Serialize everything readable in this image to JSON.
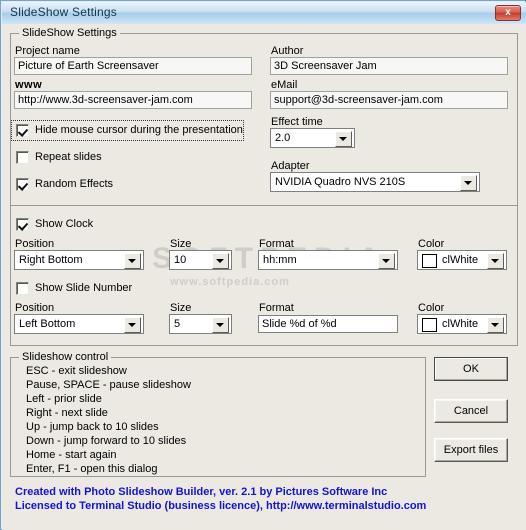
{
  "window": {
    "title": "SlideShow Settings",
    "close_label": "x",
    "accent": "#6ba7d6",
    "titlebar_color": "#a8cde9",
    "face_color": "#ece9e3"
  },
  "main_group": {
    "caption": "SlideShow Settings"
  },
  "fields": {
    "project_name": {
      "label": "Project name",
      "value": "Picture of Earth Screensaver"
    },
    "www": {
      "label": "www",
      "value": "http://www.3d-screensaver-jam.com"
    },
    "author": {
      "label": "Author",
      "value": "3D Screensaver Jam"
    },
    "email": {
      "label": "eMail",
      "value": "support@3d-screensaver-jam.com"
    },
    "effect_time": {
      "label": "Effect time",
      "value": "2.0"
    },
    "adapter": {
      "label": "Adapter",
      "value": "NVIDIA Quadro NVS 210S"
    }
  },
  "checkboxes": {
    "hide_cursor": {
      "label": "Hide mouse cursor during the presentation",
      "checked": true
    },
    "repeat_slides": {
      "label": "Repeat slides",
      "checked": false
    },
    "random_effects": {
      "label": "Random Effects",
      "checked": true
    },
    "show_clock": {
      "label": "Show Clock",
      "checked": true
    },
    "show_slide_number": {
      "label": "Show Slide Number",
      "checked": false
    }
  },
  "clock": {
    "position": {
      "label": "Position",
      "value": "Right Bottom"
    },
    "size": {
      "label": "Size",
      "value": "10"
    },
    "format": {
      "label": "Format",
      "value": "hh:mm"
    },
    "color": {
      "label": "Color",
      "value": "clWhite",
      "swatch": "#ffffff"
    }
  },
  "slide_number": {
    "position": {
      "label": "Position",
      "value": "Left Bottom"
    },
    "size": {
      "label": "Size",
      "value": "5"
    },
    "format": {
      "label": "Format",
      "value": "Slide %d of %d"
    },
    "color": {
      "label": "Color",
      "value": "clWhite",
      "swatch": "#ffffff"
    }
  },
  "slideshow_control": {
    "caption": "Slideshow control",
    "lines": [
      "ESC - exit slideshow",
      "Pause, SPACE - pause slideshow",
      "Left - prior slide",
      "Right - next slide",
      "Up - jump back to 10 slides",
      "Down - jump forward to 10 slides",
      "Home - start again",
      "Enter, F1 - open this dialog"
    ]
  },
  "buttons": {
    "ok": "OK",
    "cancel": "Cancel",
    "export": "Export files"
  },
  "footer": {
    "line1": "Created with Photo Slideshow Builder, ver. 2.1   by Pictures Software Inc",
    "line2": "Licensed to Terminal Studio (business licence), http://www.terminalstudio.com",
    "color": "#1414d2"
  },
  "watermark": {
    "line1": "SOFTPEDIA",
    "line2": "www.softpedia.com"
  }
}
